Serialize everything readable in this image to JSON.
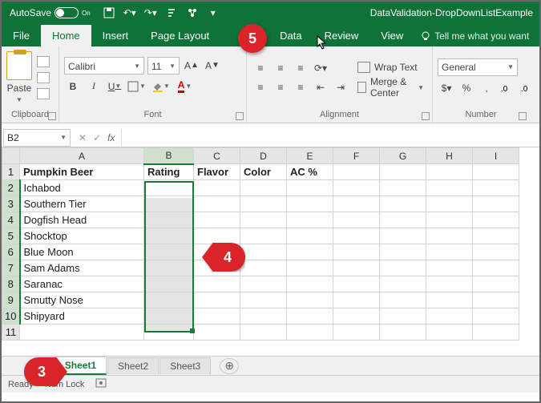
{
  "titlebar": {
    "autosave_label": "AutoSave",
    "autosave_state": "On",
    "filename": "DataValidation-DropDownListExample"
  },
  "tabs": {
    "file": "File",
    "home": "Home",
    "insert": "Insert",
    "page_layout": "Page Layout",
    "data": "Data",
    "review": "Review",
    "view": "View",
    "tell_me": "Tell me what you want"
  },
  "ribbon": {
    "clipboard": {
      "paste": "Paste",
      "label": "Clipboard"
    },
    "font": {
      "name": "Calibri",
      "size": "11",
      "label": "Font"
    },
    "alignment": {
      "wrap": "Wrap Text",
      "merge": "Merge & Center",
      "label": "Alignment"
    },
    "number": {
      "format": "General",
      "label": "Number"
    }
  },
  "namebox": "B2",
  "headers": [
    "A",
    "B",
    "C",
    "D",
    "E",
    "F",
    "G",
    "H",
    "I"
  ],
  "rows": [
    {
      "A": "Pumpkin Beer",
      "B": "Rating",
      "C": "Flavor",
      "D": "Color",
      "E": "AC %",
      "bold": true
    },
    {
      "A": "Ichabod"
    },
    {
      "A": "Southern Tier"
    },
    {
      "A": "Dogfish Head"
    },
    {
      "A": "Shocktop"
    },
    {
      "A": "Blue Moon"
    },
    {
      "A": "Sam Adams"
    },
    {
      "A": "Saranac"
    },
    {
      "A": "Smutty Nose"
    },
    {
      "A": "Shipyard"
    },
    {
      "A": ""
    }
  ],
  "col_widths": {
    "A": 155,
    "B": 62,
    "default": 58
  },
  "selection": {
    "ref": "B2:B10"
  },
  "sheets": {
    "active": "Sheet1",
    "s2": "Sheet2",
    "s3": "Sheet3"
  },
  "status": {
    "ready": "Ready",
    "numlock": "Num Lock"
  },
  "callouts": {
    "c3": "3",
    "c4": "4",
    "c5": "5"
  }
}
